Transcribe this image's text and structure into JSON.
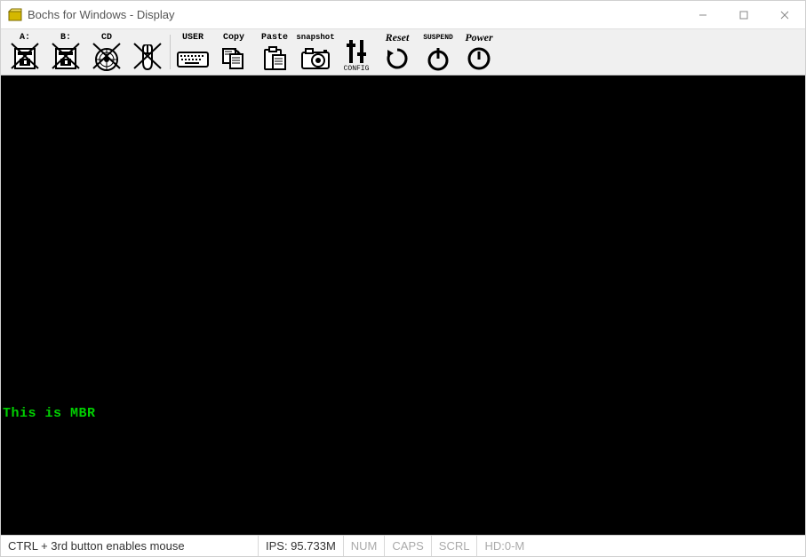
{
  "window": {
    "title": "Bochs for Windows - Display"
  },
  "toolbar": {
    "items": [
      {
        "id": "floppy-a",
        "label": "A:",
        "iconName": "floppy-a-icon",
        "disabled": true
      },
      {
        "id": "floppy-b",
        "label": "B:",
        "iconName": "floppy-b-icon",
        "disabled": true
      },
      {
        "id": "cd",
        "label": "CD",
        "iconName": "cdrom-icon",
        "disabled": true
      },
      {
        "id": "mouse",
        "label": "",
        "iconName": "mouse-icon",
        "disabled": true
      },
      {
        "id": "user",
        "label": "USER",
        "iconName": "keyboard-icon"
      },
      {
        "id": "copy",
        "label": "Copy",
        "iconName": "copy-icon"
      },
      {
        "id": "paste",
        "label": "Paste",
        "iconName": "paste-icon"
      },
      {
        "id": "snapshot",
        "label": "snapshot",
        "iconName": "camera-icon"
      },
      {
        "id": "config",
        "label": "",
        "bottom": "CONFIG",
        "iconName": "sliders-icon"
      },
      {
        "id": "reset",
        "label": "Reset",
        "italic": true,
        "iconName": "reset-icon"
      },
      {
        "id": "suspend",
        "label": "SUSPEND",
        "iconName": "suspend-icon"
      },
      {
        "id": "power",
        "label": "Power",
        "italic": true,
        "iconName": "power-icon"
      }
    ]
  },
  "console": {
    "line": "This is MBR"
  },
  "status": {
    "hint": "CTRL + 3rd button enables mouse",
    "ips": "IPS: 95.733M",
    "num": "NUM",
    "caps": "CAPS",
    "scrl": "SCRL",
    "hd": "HD:0-M"
  }
}
